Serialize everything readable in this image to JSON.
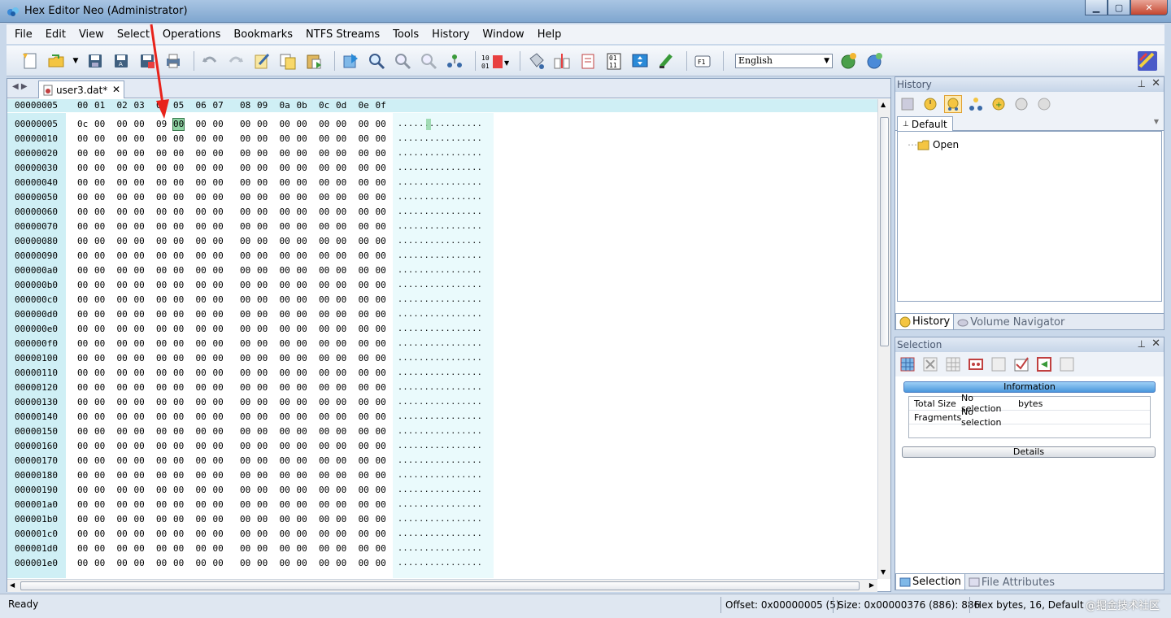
{
  "window": {
    "title": "Hex Editor Neo (Administrator)",
    "controls": [
      "minimize",
      "maximize",
      "close"
    ]
  },
  "menu": [
    "File",
    "Edit",
    "View",
    "Select",
    "Operations",
    "Bookmarks",
    "NTFS Streams",
    "Tools",
    "History",
    "Window",
    "Help"
  ],
  "toolbar": {
    "language": "English"
  },
  "editor": {
    "tab_label": "user3.dat*",
    "tab_close": "✕",
    "header_offset": "00000005",
    "column_headers": [
      "00",
      "01",
      "02",
      "03",
      "04",
      "05",
      "06",
      "07",
      "08",
      "09",
      "0a",
      "0b",
      "0c",
      "0d",
      "0e",
      "0f"
    ],
    "rows": [
      {
        "offset": "00000005",
        "bytes": [
          "0c",
          "00",
          "00",
          "00",
          "09",
          "00",
          "00",
          "00",
          "00",
          "00",
          "00",
          "00",
          "00",
          "00",
          "00",
          "00"
        ]
      },
      {
        "offset": "00000010",
        "bytes": [
          "00",
          "00",
          "00",
          "00",
          "00",
          "00",
          "00",
          "00",
          "00",
          "00",
          "00",
          "00",
          "00",
          "00",
          "00",
          "00"
        ]
      },
      {
        "offset": "00000020",
        "bytes": [
          "00",
          "00",
          "00",
          "00",
          "00",
          "00",
          "00",
          "00",
          "00",
          "00",
          "00",
          "00",
          "00",
          "00",
          "00",
          "00"
        ]
      },
      {
        "offset": "00000030",
        "bytes": [
          "00",
          "00",
          "00",
          "00",
          "00",
          "00",
          "00",
          "00",
          "00",
          "00",
          "00",
          "00",
          "00",
          "00",
          "00",
          "00"
        ]
      },
      {
        "offset": "00000040",
        "bytes": [
          "00",
          "00",
          "00",
          "00",
          "00",
          "00",
          "00",
          "00",
          "00",
          "00",
          "00",
          "00",
          "00",
          "00",
          "00",
          "00"
        ]
      },
      {
        "offset": "00000050",
        "bytes": [
          "00",
          "00",
          "00",
          "00",
          "00",
          "00",
          "00",
          "00",
          "00",
          "00",
          "00",
          "00",
          "00",
          "00",
          "00",
          "00"
        ]
      },
      {
        "offset": "00000060",
        "bytes": [
          "00",
          "00",
          "00",
          "00",
          "00",
          "00",
          "00",
          "00",
          "00",
          "00",
          "00",
          "00",
          "00",
          "00",
          "00",
          "00"
        ]
      },
      {
        "offset": "00000070",
        "bytes": [
          "00",
          "00",
          "00",
          "00",
          "00",
          "00",
          "00",
          "00",
          "00",
          "00",
          "00",
          "00",
          "00",
          "00",
          "00",
          "00"
        ]
      },
      {
        "offset": "00000080",
        "bytes": [
          "00",
          "00",
          "00",
          "00",
          "00",
          "00",
          "00",
          "00",
          "00",
          "00",
          "00",
          "00",
          "00",
          "00",
          "00",
          "00"
        ]
      },
      {
        "offset": "00000090",
        "bytes": [
          "00",
          "00",
          "00",
          "00",
          "00",
          "00",
          "00",
          "00",
          "00",
          "00",
          "00",
          "00",
          "00",
          "00",
          "00",
          "00"
        ]
      },
      {
        "offset": "000000a0",
        "bytes": [
          "00",
          "00",
          "00",
          "00",
          "00",
          "00",
          "00",
          "00",
          "00",
          "00",
          "00",
          "00",
          "00",
          "00",
          "00",
          "00"
        ]
      },
      {
        "offset": "000000b0",
        "bytes": [
          "00",
          "00",
          "00",
          "00",
          "00",
          "00",
          "00",
          "00",
          "00",
          "00",
          "00",
          "00",
          "00",
          "00",
          "00",
          "00"
        ]
      },
      {
        "offset": "000000c0",
        "bytes": [
          "00",
          "00",
          "00",
          "00",
          "00",
          "00",
          "00",
          "00",
          "00",
          "00",
          "00",
          "00",
          "00",
          "00",
          "00",
          "00"
        ]
      },
      {
        "offset": "000000d0",
        "bytes": [
          "00",
          "00",
          "00",
          "00",
          "00",
          "00",
          "00",
          "00",
          "00",
          "00",
          "00",
          "00",
          "00",
          "00",
          "00",
          "00"
        ]
      },
      {
        "offset": "000000e0",
        "bytes": [
          "00",
          "00",
          "00",
          "00",
          "00",
          "00",
          "00",
          "00",
          "00",
          "00",
          "00",
          "00",
          "00",
          "00",
          "00",
          "00"
        ]
      },
      {
        "offset": "000000f0",
        "bytes": [
          "00",
          "00",
          "00",
          "00",
          "00",
          "00",
          "00",
          "00",
          "00",
          "00",
          "00",
          "00",
          "00",
          "00",
          "00",
          "00"
        ]
      },
      {
        "offset": "00000100",
        "bytes": [
          "00",
          "00",
          "00",
          "00",
          "00",
          "00",
          "00",
          "00",
          "00",
          "00",
          "00",
          "00",
          "00",
          "00",
          "00",
          "00"
        ]
      },
      {
        "offset": "00000110",
        "bytes": [
          "00",
          "00",
          "00",
          "00",
          "00",
          "00",
          "00",
          "00",
          "00",
          "00",
          "00",
          "00",
          "00",
          "00",
          "00",
          "00"
        ]
      },
      {
        "offset": "00000120",
        "bytes": [
          "00",
          "00",
          "00",
          "00",
          "00",
          "00",
          "00",
          "00",
          "00",
          "00",
          "00",
          "00",
          "00",
          "00",
          "00",
          "00"
        ]
      },
      {
        "offset": "00000130",
        "bytes": [
          "00",
          "00",
          "00",
          "00",
          "00",
          "00",
          "00",
          "00",
          "00",
          "00",
          "00",
          "00",
          "00",
          "00",
          "00",
          "00"
        ]
      },
      {
        "offset": "00000140",
        "bytes": [
          "00",
          "00",
          "00",
          "00",
          "00",
          "00",
          "00",
          "00",
          "00",
          "00",
          "00",
          "00",
          "00",
          "00",
          "00",
          "00"
        ]
      },
      {
        "offset": "00000150",
        "bytes": [
          "00",
          "00",
          "00",
          "00",
          "00",
          "00",
          "00",
          "00",
          "00",
          "00",
          "00",
          "00",
          "00",
          "00",
          "00",
          "00"
        ]
      },
      {
        "offset": "00000160",
        "bytes": [
          "00",
          "00",
          "00",
          "00",
          "00",
          "00",
          "00",
          "00",
          "00",
          "00",
          "00",
          "00",
          "00",
          "00",
          "00",
          "00"
        ]
      },
      {
        "offset": "00000170",
        "bytes": [
          "00",
          "00",
          "00",
          "00",
          "00",
          "00",
          "00",
          "00",
          "00",
          "00",
          "00",
          "00",
          "00",
          "00",
          "00",
          "00"
        ]
      },
      {
        "offset": "00000180",
        "bytes": [
          "00",
          "00",
          "00",
          "00",
          "00",
          "00",
          "00",
          "00",
          "00",
          "00",
          "00",
          "00",
          "00",
          "00",
          "00",
          "00"
        ]
      },
      {
        "offset": "00000190",
        "bytes": [
          "00",
          "00",
          "00",
          "00",
          "00",
          "00",
          "00",
          "00",
          "00",
          "00",
          "00",
          "00",
          "00",
          "00",
          "00",
          "00"
        ]
      },
      {
        "offset": "000001a0",
        "bytes": [
          "00",
          "00",
          "00",
          "00",
          "00",
          "00",
          "00",
          "00",
          "00",
          "00",
          "00",
          "00",
          "00",
          "00",
          "00",
          "00"
        ]
      },
      {
        "offset": "000001b0",
        "bytes": [
          "00",
          "00",
          "00",
          "00",
          "00",
          "00",
          "00",
          "00",
          "00",
          "00",
          "00",
          "00",
          "00",
          "00",
          "00",
          "00"
        ]
      },
      {
        "offset": "000001c0",
        "bytes": [
          "00",
          "00",
          "00",
          "00",
          "00",
          "00",
          "00",
          "00",
          "00",
          "00",
          "00",
          "00",
          "00",
          "00",
          "00",
          "00"
        ]
      },
      {
        "offset": "000001d0",
        "bytes": [
          "00",
          "00",
          "00",
          "00",
          "00",
          "00",
          "00",
          "00",
          "00",
          "00",
          "00",
          "00",
          "00",
          "00",
          "00",
          "00"
        ]
      },
      {
        "offset": "000001e0",
        "bytes": [
          "00",
          "00",
          "00",
          "00",
          "00",
          "00",
          "00",
          "00",
          "00",
          "00",
          "00",
          "00",
          "00",
          "00",
          "00",
          "00"
        ]
      }
    ],
    "ascii_row": "................",
    "selected_column": 5
  },
  "history_panel": {
    "title": "History",
    "pin": "⊥",
    "close": "✕",
    "tab": "Default",
    "tree_item": "Open",
    "bottom_tabs": [
      "History",
      "Volume Navigator"
    ]
  },
  "selection_panel": {
    "title": "Selection",
    "pin": "⊥",
    "close": "✕",
    "information_label": "Information",
    "details_label": "Details",
    "rows": [
      {
        "name": "Total Size",
        "value": "No selection",
        "unit": "bytes"
      },
      {
        "name": "Fragments",
        "value": "No selection",
        "unit": ""
      }
    ],
    "bottom_tabs": [
      "Selection",
      "File Attributes"
    ]
  },
  "status": {
    "ready": "Ready",
    "offset": "Offset: 0x00000005 (5)",
    "size": "Size: 0x00000376 (886): 886",
    "mode": "Hex bytes, 16, Default",
    "watermark": "@掘金技术社区"
  },
  "icons": {
    "app": "hex-editor-logo-icon",
    "colors": {
      "accent": "#4a97dc",
      "offset_bg": "#cfeff5",
      "selection": "#8fd3a3",
      "annotation_arrow": "#e8231b"
    }
  }
}
